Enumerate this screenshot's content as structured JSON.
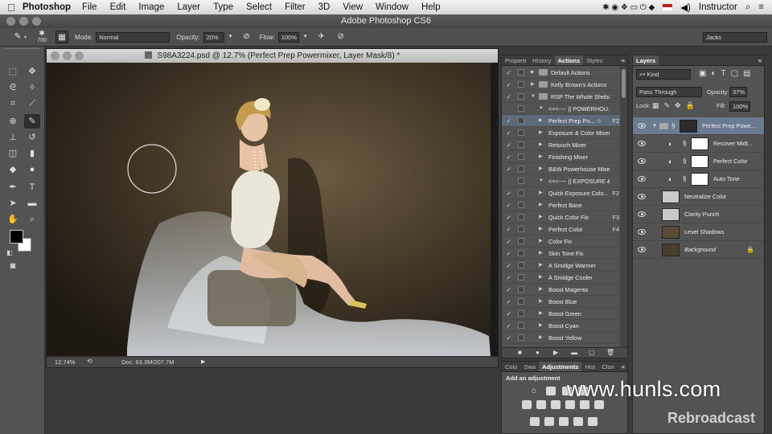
{
  "menubar": {
    "app_name": "Photoshop",
    "items": [
      "File",
      "Edit",
      "Image",
      "Layer",
      "Type",
      "Select",
      "Filter",
      "3D",
      "View",
      "Window",
      "Help"
    ],
    "user": "Instructor"
  },
  "window_title": "Adobe Photoshop CS6",
  "options_bar": {
    "brush_size": "700",
    "mode_label": "Mode:",
    "mode_value": "Normal",
    "opacity_label": "Opacity:",
    "opacity_value": "20%",
    "flow_label": "Flow:",
    "flow_value": "100%",
    "workspace": "Jacks"
  },
  "document": {
    "title": "S98A3224.psd @ 12.7% (Perfect Prep Powermixer, Layer Mask/8) *",
    "zoom": "12.74%",
    "doc_size": "Doc: 63.3M/207.7M"
  },
  "actions_panel": {
    "tabs": [
      "Properti",
      "History",
      "Actions",
      "Styles"
    ],
    "active_tab": "Actions",
    "rows": [
      {
        "label": "Default Actions",
        "key": "",
        "type": "set",
        "checked": true
      },
      {
        "label": "Kelly Brown's Actions",
        "key": "",
        "type": "set",
        "checked": true
      },
      {
        "label": "RSP The Whole Sheban...",
        "key": "",
        "type": "set-open",
        "checked": true
      },
      {
        "label": "<<<---- || POWERHOU...",
        "key": "",
        "type": "action-open",
        "checked": false
      },
      {
        "label": "Perfect Prep Po... ☆",
        "key": "F2",
        "type": "action",
        "checked": true
      },
      {
        "label": "Exposure & Color Mixer",
        "key": "",
        "type": "action",
        "checked": true
      },
      {
        "label": "Retouch Mixer",
        "key": "",
        "type": "action",
        "checked": true
      },
      {
        "label": "Finishing Mixer",
        "key": "",
        "type": "action",
        "checked": true
      },
      {
        "label": "B&W Powerhouse Mixer",
        "key": "",
        "type": "action",
        "checked": true
      },
      {
        "label": "<<<---- || EXPOSURE &...",
        "key": "",
        "type": "action-open",
        "checked": false
      },
      {
        "label": "Quick Exposure Colo...",
        "key": "F2",
        "type": "action",
        "checked": true
      },
      {
        "label": "Perfect Base",
        "key": "",
        "type": "action",
        "checked": true
      },
      {
        "label": "Quick Color Fix",
        "key": "F3",
        "type": "action",
        "checked": true
      },
      {
        "label": "Perfect Color",
        "key": "F4",
        "type": "action",
        "checked": true
      },
      {
        "label": "Color Fix",
        "key": "",
        "type": "action",
        "checked": true
      },
      {
        "label": "Skin Tone Fix",
        "key": "",
        "type": "action",
        "checked": true
      },
      {
        "label": "A Smidge Warmer",
        "key": "",
        "type": "action",
        "checked": true
      },
      {
        "label": "A Smidge Cooler",
        "key": "",
        "type": "action",
        "checked": true
      },
      {
        "label": "Boost Magenta",
        "key": "",
        "type": "action",
        "checked": true
      },
      {
        "label": "Boost Blue",
        "key": "",
        "type": "action",
        "checked": true
      },
      {
        "label": "Boost Green",
        "key": "",
        "type": "action",
        "checked": true
      },
      {
        "label": "Boost Cyan",
        "key": "",
        "type": "action",
        "checked": true
      },
      {
        "label": "Boost Yellow",
        "key": "",
        "type": "action",
        "checked": true
      }
    ]
  },
  "adjustments_panel": {
    "tabs": [
      "Colo",
      "Swa",
      "Adjustments",
      "Hist",
      "Clon"
    ],
    "active_tab": "Adjustments",
    "heading": "Add an adjustment"
  },
  "layers_panel": {
    "tab": "Layers",
    "filter": "Kind",
    "blend_mode": "Pass Through",
    "opacity_label": "Opacity:",
    "opacity_value": "37%",
    "lock_label": "Lock:",
    "fill_label": "Fill:",
    "fill_value": "100%",
    "layers": [
      {
        "name": "Perfect Prep Powe...",
        "kind": "group"
      },
      {
        "name": "Recover Midt...",
        "kind": "adjustment"
      },
      {
        "name": "Perfect Color",
        "kind": "adjustment"
      },
      {
        "name": "Auto Tone",
        "kind": "adjustment"
      },
      {
        "name": "Neutralize Color",
        "kind": "fill"
      },
      {
        "name": "Clarity Punch",
        "kind": "fill"
      },
      {
        "name": "Level Shadows",
        "kind": "image"
      },
      {
        "name": "Background",
        "kind": "background"
      }
    ]
  },
  "watermark": {
    "site": "www.hunls.com",
    "brand": "Rebroadcast"
  }
}
